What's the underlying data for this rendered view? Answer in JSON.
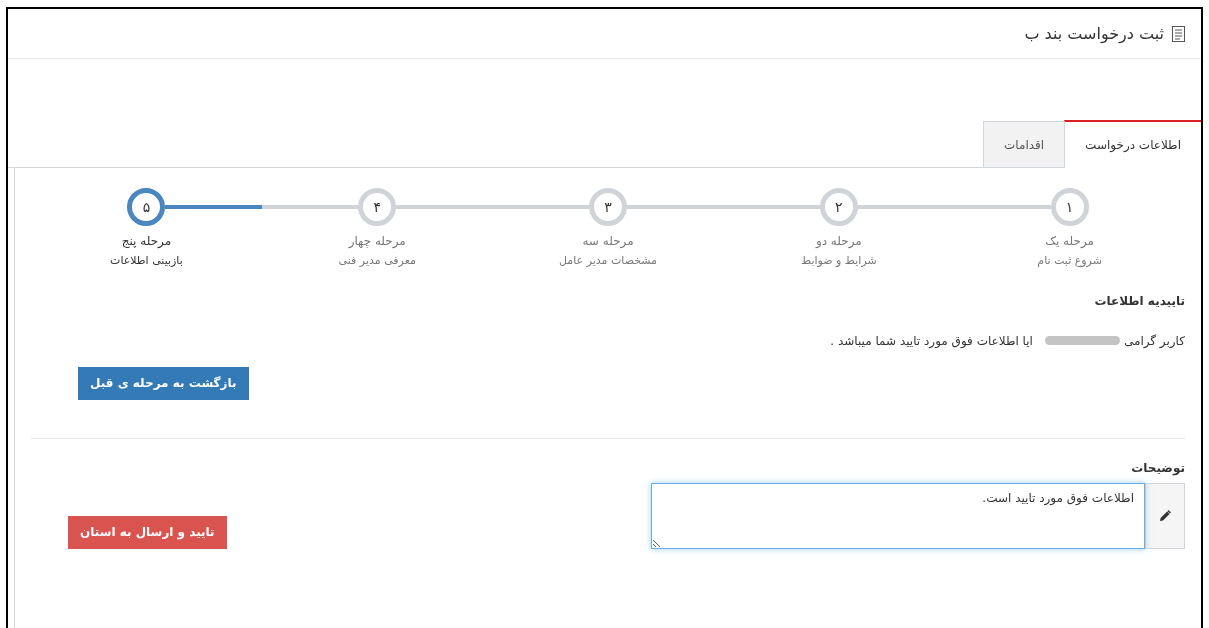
{
  "page": {
    "title": "ثبت درخواست بند ب"
  },
  "tabs": [
    {
      "label": "اطلاعات درخواست",
      "selected": true
    },
    {
      "label": "اقدامات",
      "selected": false
    }
  ],
  "steps": [
    {
      "number": "۱",
      "title": "مرحله یک",
      "subtitle": "شروع ثبت نام",
      "active": false
    },
    {
      "number": "۲",
      "title": "مرحله دو",
      "subtitle": "شرایط و ضوابط",
      "active": false
    },
    {
      "number": "۳",
      "title": "مرحله سه",
      "subtitle": "مشخصات مدیر عامل",
      "active": false
    },
    {
      "number": "۴",
      "title": "مرحله چهار",
      "subtitle": "معرفی مدیر فنی",
      "active": false
    },
    {
      "number": "۵",
      "title": "مرحله پنج",
      "subtitle": "بازبینی اطلاعات",
      "active": true
    }
  ],
  "confirmation": {
    "heading": "تاییدیه اطلاعات",
    "greeting": "کاربر گرامی",
    "question": "ایا اطلاعات فوق مورد تایید شما میباشد ."
  },
  "back_button": "بازگشت به مرحله ی قبل",
  "notes": {
    "label": "توضیحات",
    "value": "اطلاعات فوق مورد تایید است."
  },
  "submit_button": "تایید و ارسال به استان"
}
